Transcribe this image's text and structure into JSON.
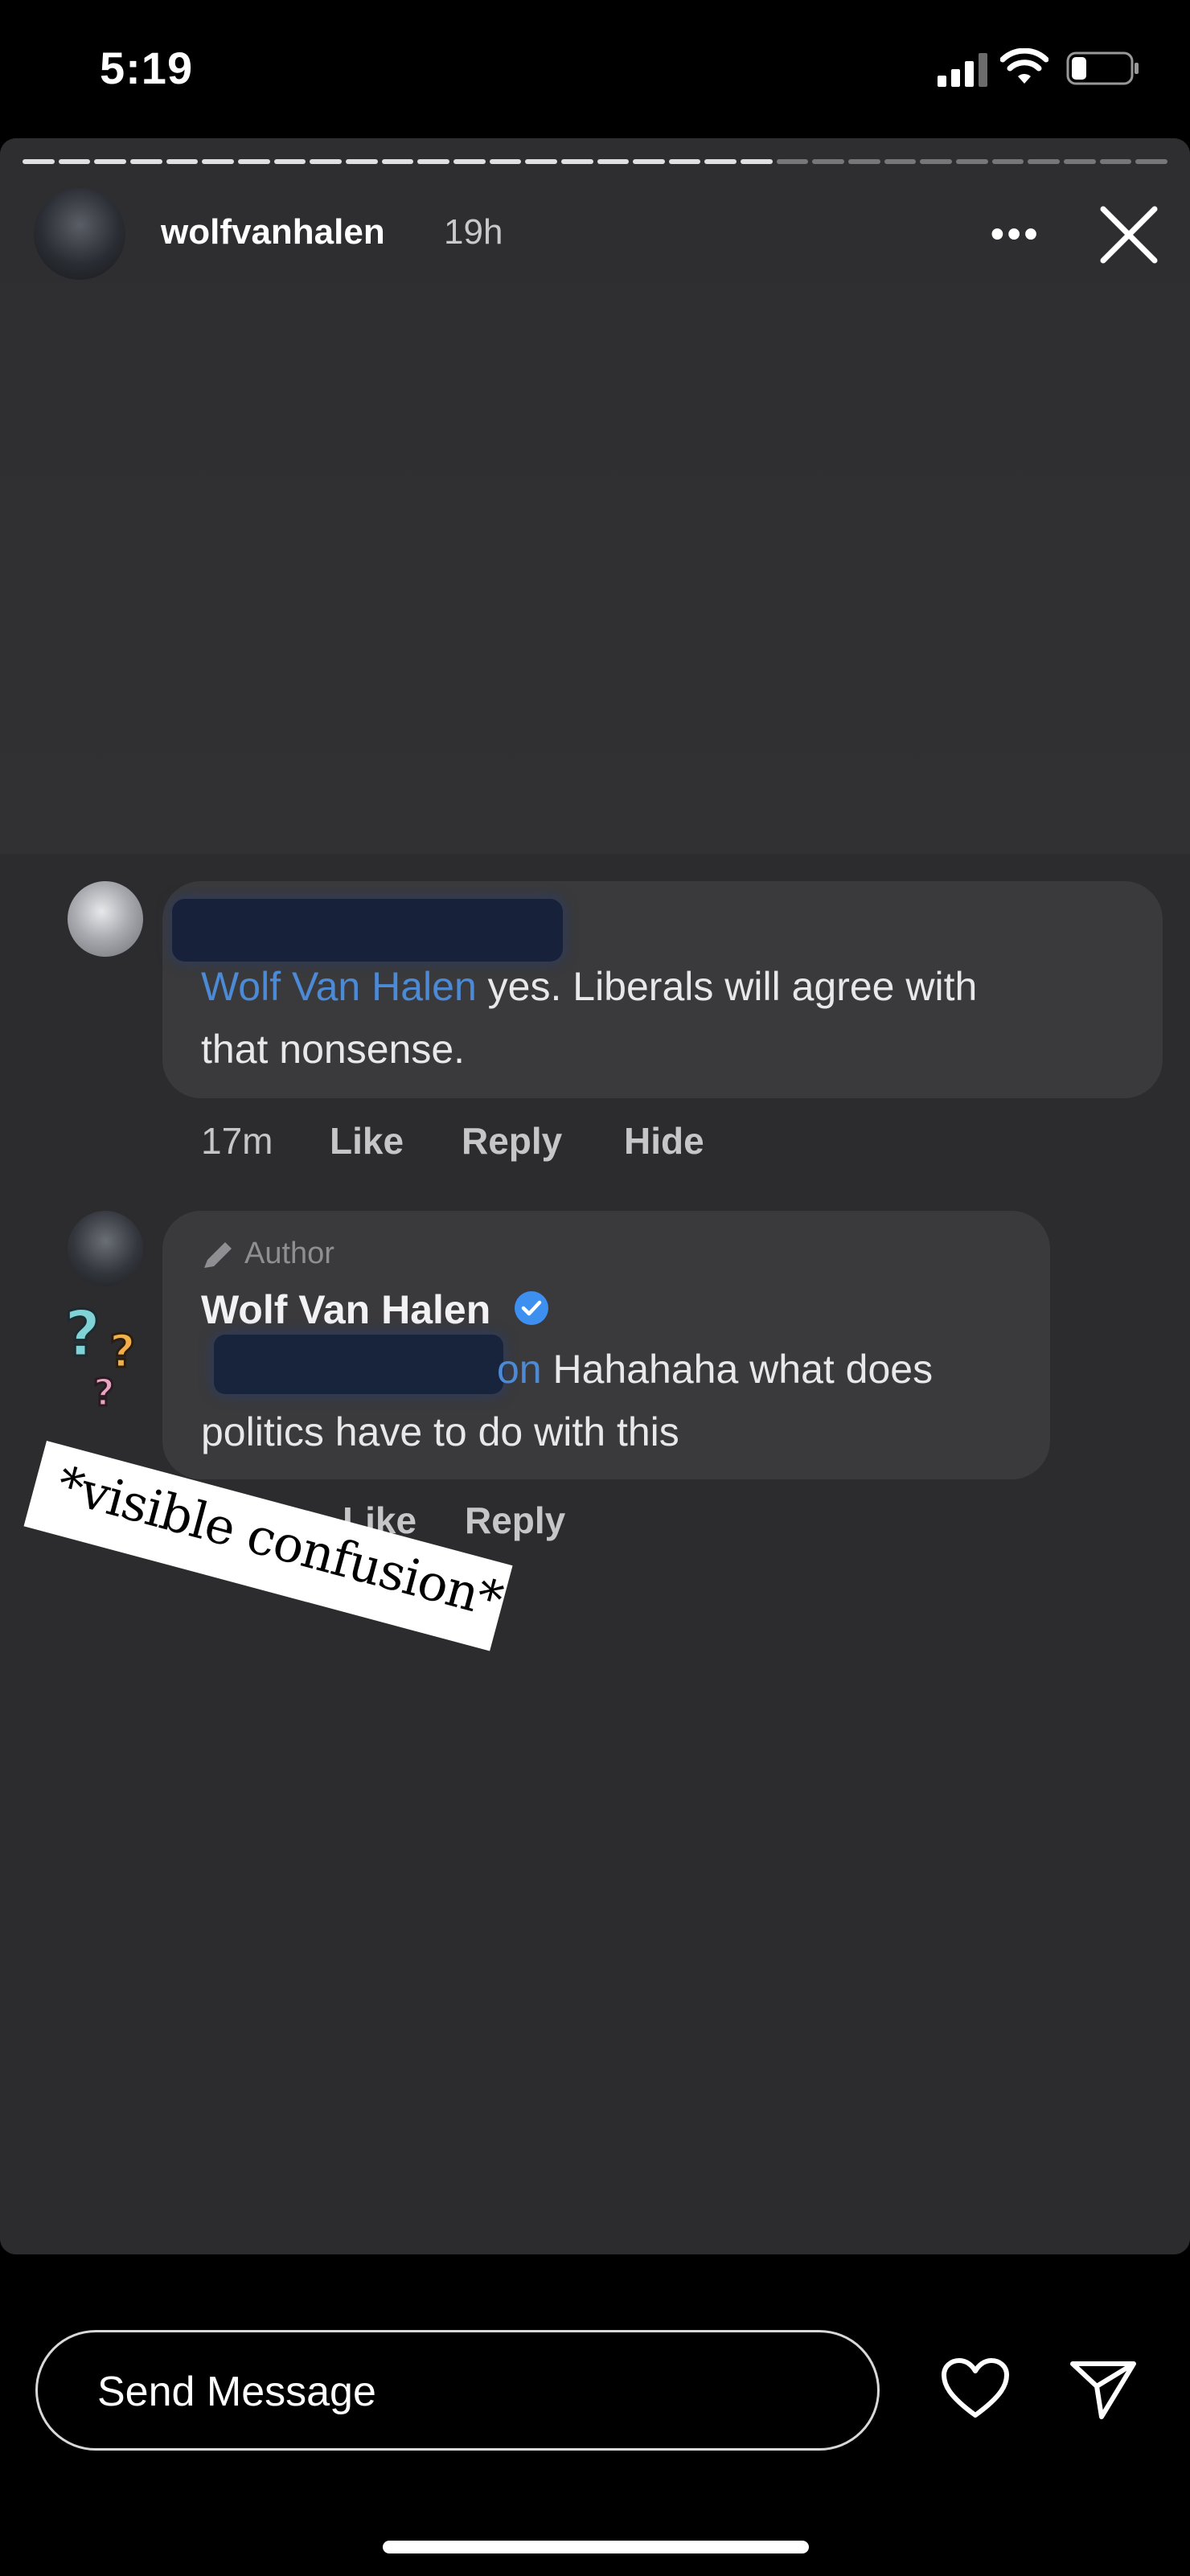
{
  "status_bar": {
    "time": "5:19"
  },
  "story": {
    "username": "wolfvanhalen",
    "time_ago": "19h",
    "progress": {
      "segments": 32,
      "completed": 21
    }
  },
  "comments": [
    {
      "mention": "Wolf Van Halen",
      "text_line1": " yes. Liberals will agree with",
      "text_line2": "that nonsense.",
      "time": "17m",
      "actions": [
        "Like",
        "Reply",
        "Hide"
      ]
    },
    {
      "author_badge": "Author",
      "name": "Wolf Van Halen",
      "mention_fragment": "on",
      "text_line1": " Hahahaha what does",
      "text_line2": "politics have to do with this",
      "actions_visible": [
        "Like",
        "Reply"
      ]
    }
  ],
  "sticker": {
    "text": "*visible confusion*"
  },
  "composer": {
    "placeholder": "Send Message"
  }
}
